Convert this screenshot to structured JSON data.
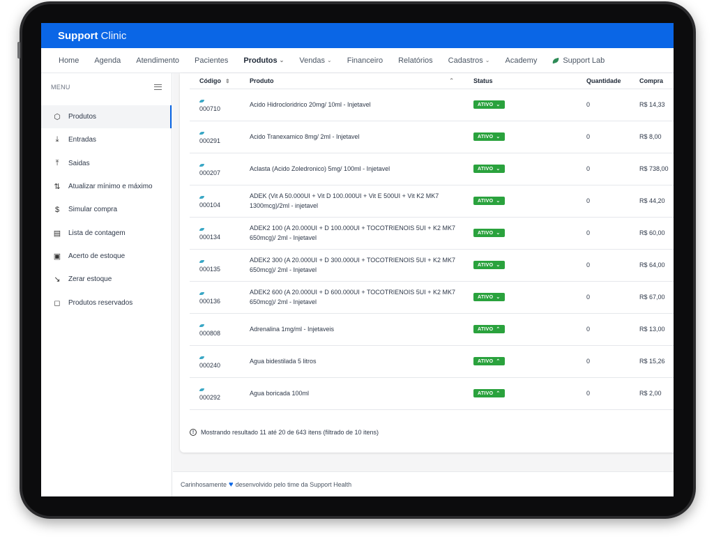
{
  "app": {
    "brand_bold": "Support",
    "brand_light": "Clinic"
  },
  "topnav": [
    {
      "label": "Home",
      "dropdown": false,
      "active": false
    },
    {
      "label": "Agenda",
      "dropdown": false,
      "active": false
    },
    {
      "label": "Atendimento",
      "dropdown": false,
      "active": false
    },
    {
      "label": "Pacientes",
      "dropdown": false,
      "active": false
    },
    {
      "label": "Produtos",
      "dropdown": true,
      "active": true
    },
    {
      "label": "Vendas",
      "dropdown": true,
      "active": false
    },
    {
      "label": "Financeiro",
      "dropdown": false,
      "active": false
    },
    {
      "label": "Relatórios",
      "dropdown": false,
      "active": false
    },
    {
      "label": "Cadastros",
      "dropdown": true,
      "active": false
    },
    {
      "label": "Academy",
      "dropdown": false,
      "active": false
    },
    {
      "label": "Support Lab",
      "dropdown": false,
      "active": false,
      "leaf": true
    }
  ],
  "sidebar": {
    "header": "MENU",
    "items": [
      {
        "label": "Produtos",
        "icon": "box-icon",
        "glyph": "⬡",
        "active": true
      },
      {
        "label": "Entradas",
        "icon": "download-icon",
        "glyph": "⤓"
      },
      {
        "label": "Saidas",
        "icon": "upload-icon",
        "glyph": "⤒"
      },
      {
        "label": "Atualizar mínimo e máximo",
        "icon": "sort-arrows-icon",
        "glyph": "⇅"
      },
      {
        "label": "Simular compra",
        "icon": "dollar-icon",
        "glyph": "$"
      },
      {
        "label": "Lista de contagem",
        "icon": "clipboard-icon",
        "glyph": "▤"
      },
      {
        "label": "Acerto de estoque",
        "icon": "archive-icon",
        "glyph": "▣"
      },
      {
        "label": "Zerar estoque",
        "icon": "trend-down-icon",
        "glyph": "↘"
      },
      {
        "label": "Produtos reservados",
        "icon": "shopping-bag-icon",
        "glyph": "◻"
      }
    ]
  },
  "table": {
    "columns": [
      "Código",
      "Produto",
      "Status",
      "Quantidade",
      "Compra"
    ],
    "rows": [
      {
        "code": "000710",
        "product": "Acido Hidrocloridrico 20mg/ 10ml - Injetavel",
        "status": "ATIVO",
        "open": false,
        "qty": "0",
        "price": "R$ 14,33"
      },
      {
        "code": "000291",
        "product": "Acido Tranexamico 8mg/ 2ml - Injetavel",
        "status": "ATIVO",
        "open": false,
        "qty": "0",
        "price": "R$ 8,00"
      },
      {
        "code": "000207",
        "product": "Aclasta (Acido Zoledronico) 5mg/ 100ml - Injetavel",
        "status": "ATIVO",
        "open": false,
        "qty": "0",
        "price": "R$ 738,00"
      },
      {
        "code": "000104",
        "product": "ADEK (Vit A 50.000UI + Vit D 100.000UI + Vit E 500UI + Vit K2 MK7 1300mcg)/2ml - injetavel",
        "status": "ATIVO",
        "open": false,
        "qty": "0",
        "price": "R$ 44,20"
      },
      {
        "code": "000134",
        "product": "ADEK2 100 (A 20.000UI + D 100.000UI + TOCOTRIENOIS 5UI + K2 MK7 650mcg)/ 2ml - Injetavel",
        "status": "ATIVO",
        "open": false,
        "qty": "0",
        "price": "R$ 60,00"
      },
      {
        "code": "000135",
        "product": "ADEK2 300 (A 20.000UI + D 300.000UI + TOCOTRIENOIS 5UI + K2 MK7 650mcg)/ 2ml - Injetavel",
        "status": "ATIVO",
        "open": false,
        "qty": "0",
        "price": "R$ 64,00"
      },
      {
        "code": "000136",
        "product": "ADEK2 600 (A 20.000UI + D 600.000UI + TOCOTRIENOIS 5UI + K2 MK7 650mcg)/ 2ml - Injetavel",
        "status": "ATIVO",
        "open": false,
        "qty": "0",
        "price": "R$ 67,00"
      },
      {
        "code": "000808",
        "product": "Adrenalina 1mg/ml - Injetaveis",
        "status": "ATIVO",
        "open": true,
        "qty": "0",
        "price": "R$ 13,00"
      },
      {
        "code": "000240",
        "product": "Agua bidestilada 5 litros",
        "status": "ATIVO",
        "open": true,
        "qty": "0",
        "price": "R$ 15,26"
      },
      {
        "code": "000292",
        "product": "Agua boricada 100ml",
        "status": "ATIVO",
        "open": true,
        "qty": "0",
        "price": "R$ 2,00"
      }
    ]
  },
  "summary": "Mostrando resultado 11 até 20 de 643 itens (filtrado de 10 itens)",
  "footer": {
    "before": "Carinhosamente",
    "after": "desenvolvido pelo time da Support Health"
  },
  "colors": {
    "primary": "#0a66e6",
    "status_active": "#2aa23d"
  }
}
